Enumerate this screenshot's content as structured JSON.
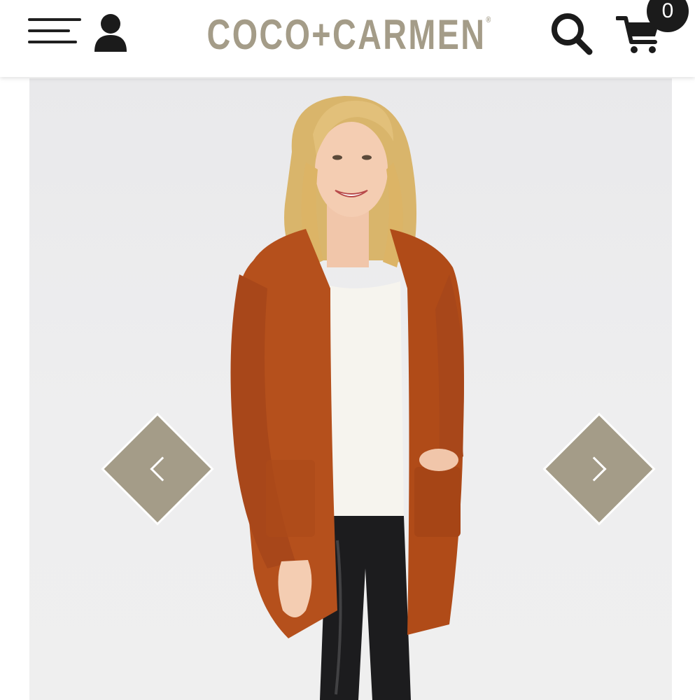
{
  "header": {
    "brand": "COCO+CARMEN",
    "brand_mark": "®",
    "cart_count": "0",
    "icons": {
      "menu": "hamburger-menu-icon",
      "account": "user-icon",
      "search": "search-icon",
      "cart": "cart-icon"
    }
  },
  "gallery": {
    "prev_icon": "chevron-left-icon",
    "next_icon": "chevron-right-icon"
  },
  "colors": {
    "brand": "#a49c88",
    "icon": "#1b1b1b",
    "cardigan": "#b5501c",
    "background": "#ffffff"
  }
}
